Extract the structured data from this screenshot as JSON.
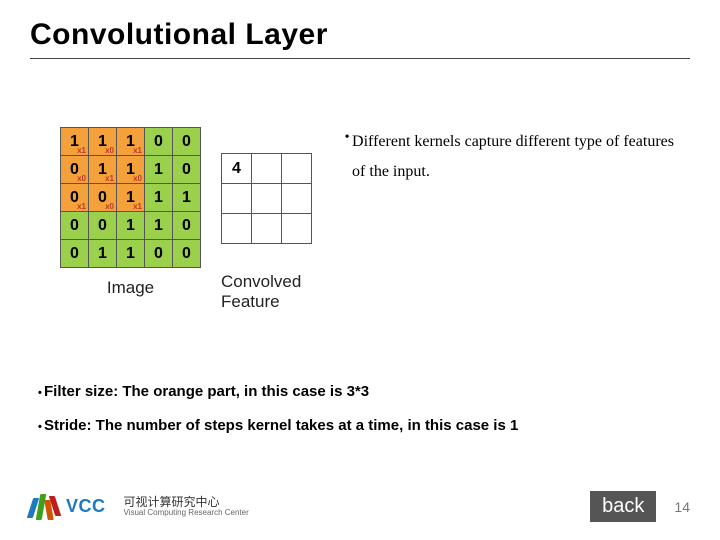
{
  "title": "Convolutional Layer",
  "image": {
    "label": "Image",
    "grid": [
      [
        {
          "v": "1",
          "sub": "x1",
          "k": true
        },
        {
          "v": "1",
          "sub": "x0",
          "k": true
        },
        {
          "v": "1",
          "sub": "x1",
          "k": true
        },
        {
          "v": "0"
        },
        {
          "v": "0"
        }
      ],
      [
        {
          "v": "0",
          "sub": "x0",
          "k": true
        },
        {
          "v": "1",
          "sub": "x1",
          "k": true
        },
        {
          "v": "1",
          "sub": "x0",
          "k": true
        },
        {
          "v": "1"
        },
        {
          "v": "0"
        }
      ],
      [
        {
          "v": "0",
          "sub": "x1",
          "k": true
        },
        {
          "v": "0",
          "sub": "x0",
          "k": true
        },
        {
          "v": "1",
          "sub": "x1",
          "k": true
        },
        {
          "v": "1"
        },
        {
          "v": "1"
        }
      ],
      [
        {
          "v": "0"
        },
        {
          "v": "0"
        },
        {
          "v": "1"
        },
        {
          "v": "1"
        },
        {
          "v": "0"
        }
      ],
      [
        {
          "v": "0"
        },
        {
          "v": "1"
        },
        {
          "v": "1"
        },
        {
          "v": "0"
        },
        {
          "v": "0"
        }
      ]
    ]
  },
  "convolved": {
    "label_line1": "Convolved",
    "label_line2": "Feature",
    "grid": [
      [
        "4",
        "",
        ""
      ],
      [
        "",
        "",
        ""
      ],
      [
        "",
        "",
        ""
      ]
    ]
  },
  "right_bullet": "Different kernels capture different type of features of the input.",
  "lower_bullets": [
    "Filter size: The orange part, in this case is 3*3",
    "Stride: The number of steps kernel takes at a time, in this case is 1"
  ],
  "footer": {
    "logo_abbr": "VCC",
    "logo_cn": "可视计算研究中心",
    "logo_en": "Visual Computing Research Center",
    "back_label": "back",
    "page": "14"
  }
}
